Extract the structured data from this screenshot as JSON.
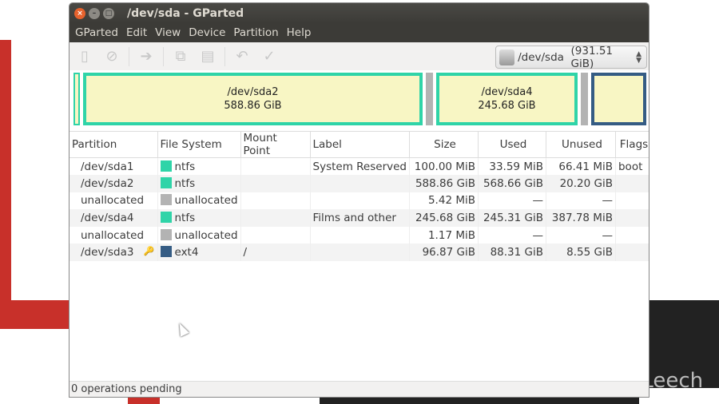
{
  "window": {
    "title": "/dev/sda - GParted"
  },
  "menu": [
    "GParted",
    "Edit",
    "View",
    "Device",
    "Partition",
    "Help"
  ],
  "toolbar": {
    "icons": [
      "new-icon",
      "delete-icon",
      "resize-move-icon",
      "copy-icon",
      "paste-icon",
      "undo-icon",
      "apply-icon"
    ]
  },
  "device": {
    "name": "/dev/sda",
    "size": "(931.51 GiB)"
  },
  "map": {
    "sda2": {
      "name": "/dev/sda2",
      "size": "588.86 GiB"
    },
    "sda4": {
      "name": "/dev/sda4",
      "size": "245.68 GiB"
    }
  },
  "columns": [
    "Partition",
    "File System",
    "Mount Point",
    "Label",
    "Size",
    "Used",
    "Unused",
    "Flags"
  ],
  "rows": [
    {
      "partition": "/dev/sda1",
      "fs": "ntfs",
      "color": "#2fd4a8",
      "mount": "",
      "label": "System Reserved",
      "size": "100.00 MiB",
      "used": "33.59 MiB",
      "unused": "66.41 MiB",
      "flags": "boot"
    },
    {
      "partition": "/dev/sda2",
      "fs": "ntfs",
      "color": "#2fd4a8",
      "mount": "",
      "label": "",
      "size": "588.86 GiB",
      "used": "568.66 GiB",
      "unused": "20.20 GiB",
      "flags": ""
    },
    {
      "partition": "unallocated",
      "fs": "unallocated",
      "color": "#b3b3b3",
      "mount": "",
      "label": "",
      "size": "5.42 MiB",
      "used": "—",
      "unused": "—",
      "flags": ""
    },
    {
      "partition": "/dev/sda4",
      "fs": "ntfs",
      "color": "#2fd4a8",
      "mount": "",
      "label": "Films and other",
      "size": "245.68 GiB",
      "used": "245.31 GiB",
      "unused": "387.78 MiB",
      "flags": ""
    },
    {
      "partition": "unallocated",
      "fs": "unallocated",
      "color": "#b3b3b3",
      "mount": "",
      "label": "",
      "size": "1.17 MiB",
      "used": "—",
      "unused": "—",
      "flags": ""
    },
    {
      "partition": "/dev/sda3",
      "fs": "ext4",
      "color": "#355c84",
      "mount": "/",
      "label": "",
      "size": "96.87 GiB",
      "used": "88.31 GiB",
      "unused": "8.55 GiB",
      "flags": ""
    }
  ],
  "status": "0 operations pending",
  "watermark": "Linux Leech"
}
